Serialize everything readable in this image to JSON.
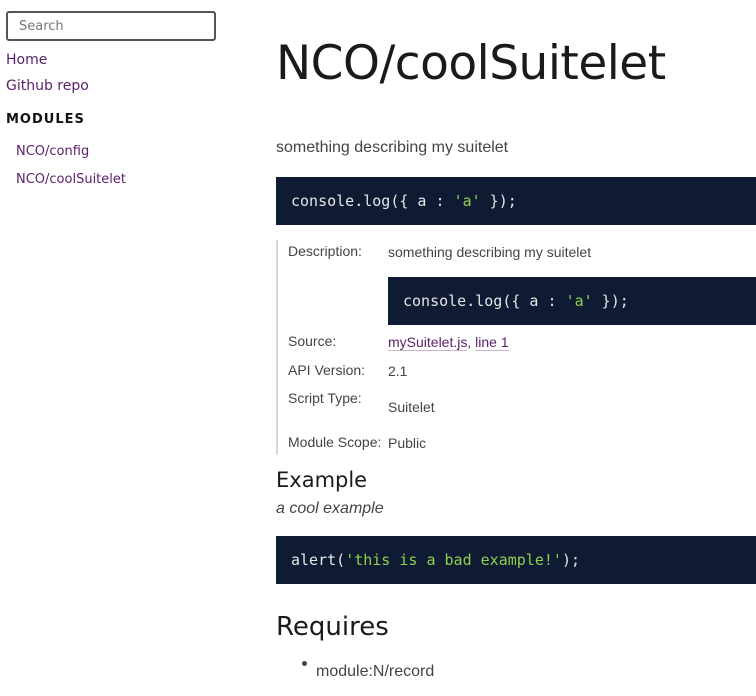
{
  "sidebar": {
    "search_placeholder": "Search",
    "links": [
      "Home",
      "Github repo"
    ],
    "modules_heading": "MODULES",
    "modules": [
      "NCO/config",
      "NCO/coolSuitelet"
    ]
  },
  "main": {
    "title": "NCO/coolSuitelet",
    "description": "something describing my suitelet",
    "code_example_1": {
      "pre": "console.log({ a : ",
      "str": "'a'",
      "post": " });"
    },
    "details": {
      "description_label": "Description:",
      "description_value": "something describing my suitelet",
      "code": {
        "pre": "console.log({ a : ",
        "str": "'a'",
        "post": " });"
      },
      "source_label": "Source:",
      "source_file": "mySuitelet.js",
      "source_sep": ", ",
      "source_line": "line 1",
      "api_label": "API Version:",
      "api_value": "2.1",
      "script_type_label": "Script Type:",
      "script_type_value": "Suitelet",
      "scope_label": "Module Scope:",
      "scope_value": "Public"
    },
    "example_heading": "Example",
    "example_caption": "a cool example",
    "example_code": {
      "pre": "alert(",
      "str": "'this is a bad example!'",
      "post": ");"
    },
    "requires_heading": "Requires",
    "requires": [
      "module:N/record"
    ]
  },
  "colors": {
    "link": "#5a1f6a",
    "code_bg": "#0f1a33",
    "code_string": "#8fd14f"
  }
}
